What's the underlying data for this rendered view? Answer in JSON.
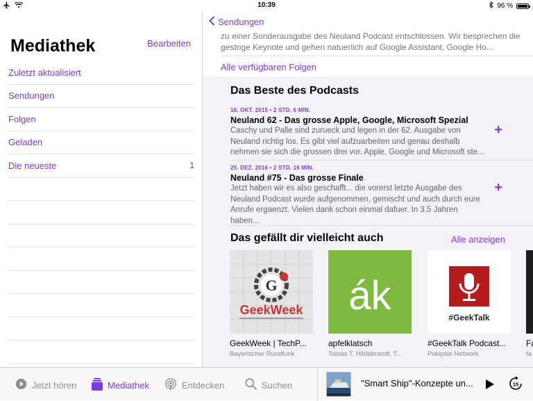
{
  "status": {
    "time": "10:39",
    "battery": "96 %"
  },
  "sidebar": {
    "title": "Mediathek",
    "edit_label": "Bearbeiten",
    "items": [
      {
        "label": "Zuletzt aktualisiert",
        "count": ""
      },
      {
        "label": "Sendungen",
        "count": ""
      },
      {
        "label": "Folgen",
        "count": ""
      },
      {
        "label": "Geladen",
        "count": ""
      },
      {
        "label": "Die neueste",
        "count": "1"
      }
    ]
  },
  "detail": {
    "back_label": "Sendungen",
    "description": "zu einer Sonderausgabe des Neuland Podcast entschlossen. Wir besprechen die gestrige Keynote und gehen natuerlich auf Google Assistant, Google Ho...",
    "all_episodes_label": "Alle verfügbaren Folgen",
    "best_title": "Das Beste des Podcasts",
    "episodes": [
      {
        "date": "16. OKT. 2015 • 2 STD. 6 MIN.",
        "title": "Neuland 62 - Das grosse Apple, Google, Microsoft Spezial",
        "summary": "Caschy und Palle sind zurueck und legen in der 62. Ausgabe von Neuland richtig los. Es gibt viel aufzuarbeiten und genau deshalb nehmen sie sich die grossen drei vor. Apple, Google und Microsoft ste..."
      },
      {
        "date": "25. DEZ. 2016 • 2 STD. 16 MIN.",
        "title": "Neuland #75 - Das grosse Finale",
        "summary": "Jetzt haben wir es also geschafft... die vorerst letzte Ausgabe des Neuland Podcast wurde aufgenommen, gemischt und auch durch eure Anrufe ergaenzt. Vielen dank schon einmal dafuer. In 3.5 Jahren haben..."
      }
    ],
    "recommend_title": "Das gefällt dir vielleicht auch",
    "see_all_label": "Alle anzeigen",
    "podcasts": [
      {
        "name": "GeekWeek | TechP...",
        "publisher": "Bayerischer Rundfunk",
        "art_text": "GeekWeek",
        "art_letter": "G"
      },
      {
        "name": "apfelklatsch",
        "publisher": "Tobias T. Hildebrandt, T...",
        "art_text": "ák"
      },
      {
        "name": "#GeekTalk Podcast...",
        "publisher": "Pokipsie Network",
        "art_text": "#GeekTalk"
      },
      {
        "name": "Fa",
        "publisher": "fa"
      }
    ]
  },
  "tabbar": {
    "tabs": [
      {
        "label": "Jetzt hören",
        "icon": "play-circle-icon"
      },
      {
        "label": "Mediathek",
        "icon": "library-icon"
      },
      {
        "label": "Entdecken",
        "icon": "podcast-icon"
      },
      {
        "label": "Suchen",
        "icon": "search-icon"
      }
    ],
    "now_playing": "\"Smart Ship\"-Konzepte un..."
  }
}
